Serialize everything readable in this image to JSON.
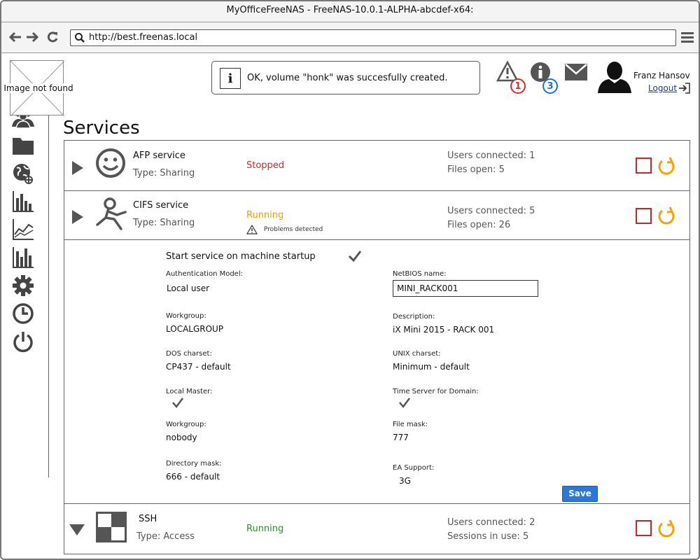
{
  "window": {
    "title": "MyOfficeFreeNAS - FreeNAS-10.0.1-ALPHA-abcdef-x64:"
  },
  "browser": {
    "url": "http://best.freenas.local"
  },
  "logo": {
    "alt_text": "Image not found"
  },
  "sidebar": {
    "items": [
      {
        "icon": "users-icon"
      },
      {
        "icon": "folder-icon"
      },
      {
        "icon": "globe-icon"
      },
      {
        "icon": "bar-chart-icon"
      },
      {
        "icon": "line-chart-icon"
      },
      {
        "icon": "reports-icon"
      },
      {
        "icon": "gear-icon"
      },
      {
        "icon": "clock-icon"
      },
      {
        "icon": "power-icon"
      }
    ]
  },
  "notification": {
    "icon": "info-icon",
    "text": "OK, volume \"honk\" was succesfully created."
  },
  "header": {
    "alerts_count": "1",
    "info_count": "3",
    "alert_color": "#d32f2f",
    "info_color": "#1e6fd9",
    "user_name": "Franz Hansov",
    "logout_label": "Logout"
  },
  "page": {
    "title": "Services"
  },
  "services": [
    {
      "name": "AFP service",
      "type": "Type: Sharing",
      "status": "Stopped",
      "status_color": "#c62828",
      "stat1": "Users connected: 1",
      "stat2": "Files open: 5",
      "icon": "smiley-icon"
    },
    {
      "name": "CIFS service",
      "type": "Type: Sharing",
      "status": "Running",
      "status_color": "#f39c12",
      "problem": "Problems detected",
      "stat1": "Users connected: 5",
      "stat2": "Files open: 26",
      "icon": "runner-icon"
    },
    {
      "name": "SSH",
      "type": "Type: Access",
      "status": "Running",
      "status_color": "#2e8b2e",
      "stat1": "Users connected: 2",
      "stat2": "Sessions in use: 5",
      "icon": "checker-icon"
    }
  ],
  "cifs_detail": {
    "start_on_boot_label": "Start service on machine startup",
    "start_on_boot": true,
    "auth_model_label": "Authentication Model:",
    "auth_model": "Local user",
    "netbios_label": "NetBIOS name:",
    "netbios": "MINI_RACK001",
    "workgroup_label": "Workgroup:",
    "workgroup": "LOCALGROUP",
    "description_label": "Description:",
    "description": "iX Mini 2015 -  RACK 001",
    "dos_charset_label": "DOS charset:",
    "dos_charset": "CP437 - default",
    "unix_charset_label": "UNIX charset:",
    "unix_charset": "Minimum -  default",
    "local_master_label": "Local Master:",
    "local_master": true,
    "time_server_label": "Time Server for Domain:",
    "time_server": true,
    "workgroup2_label": "Workgroup:",
    "workgroup2": "nobody",
    "file_mask_label": "File mask:",
    "file_mask": "777",
    "dir_mask_label": "Directory mask:",
    "dir_mask": "666 - default",
    "ea_support_label": "EA Support:",
    "ea_support": "3G",
    "save_label": "Save"
  }
}
